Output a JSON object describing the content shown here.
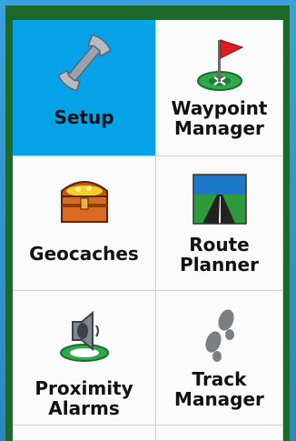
{
  "menu": {
    "tiles": [
      {
        "label": "Setup",
        "icon": "wrench-icon",
        "selected": true
      },
      {
        "label": "Waypoint\nManager",
        "icon": "flag-icon",
        "selected": false
      },
      {
        "label": "Geocaches",
        "icon": "treasure-chest-icon",
        "selected": false
      },
      {
        "label": "Route\nPlanner",
        "icon": "road-icon",
        "selected": false
      },
      {
        "label": "Proximity\nAlarms",
        "icon": "speaker-alarm-icon",
        "selected": false
      },
      {
        "label": "Track\nManager",
        "icon": "footprints-icon",
        "selected": false
      }
    ]
  },
  "colors": {
    "selected": "#06a2e8",
    "screen_border": "#1c6a2a",
    "bezel": "#2d86c4"
  }
}
